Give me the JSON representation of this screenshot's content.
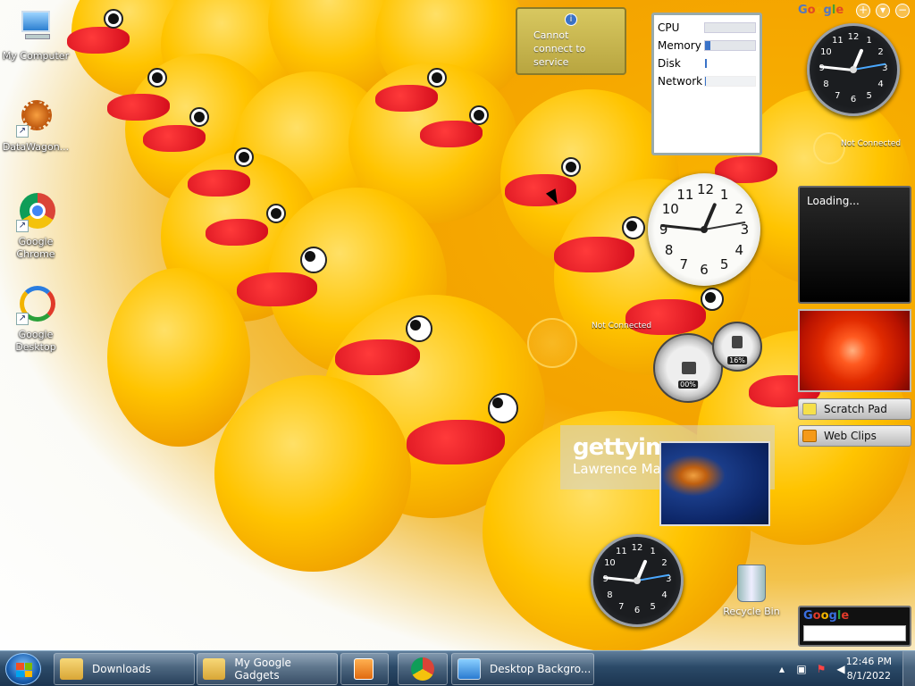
{
  "desktop_icons": [
    {
      "label": "My Computer",
      "icon": "computer-icon"
    },
    {
      "label": "DataWagon...",
      "icon": "datawagon-icon"
    },
    {
      "label": "Google Chrome",
      "icon": "chrome-icon"
    },
    {
      "label": "Google Desktop",
      "icon": "google-desktop-icon"
    }
  ],
  "weather_gadget": {
    "message": "Cannot connect to service",
    "info_icon": "i"
  },
  "system_monitor": {
    "rows": [
      {
        "label": "CPU",
        "level": 0.0
      },
      {
        "label": "Memory",
        "level": 0.1
      },
      {
        "label": "Disk",
        "level": 0.03
      },
      {
        "label": "Network",
        "level": 0.02
      }
    ]
  },
  "clock_top_right": {
    "not_connected": "Not Connected",
    "numerals": [
      "12",
      "1",
      "2",
      "3",
      "4",
      "5",
      "6",
      "7",
      "8",
      "9",
      "10",
      "11"
    ]
  },
  "clock_middle": {
    "not_connected": "Not Connected"
  },
  "gauges": {
    "cpu_percent": "00%",
    "memory_percent": "16%"
  },
  "slideshow": {
    "status": "Loading..."
  },
  "sidebar_buttons": {
    "scratch_pad": "Scratch Pad",
    "web_clips": "Web Clips"
  },
  "google_logo": [
    "G",
    "o",
    "o",
    "g",
    "l",
    "e"
  ],
  "getty_watermark": {
    "brand": "gettyimages",
    "credit": "Lawrence Ma"
  },
  "recycle_bin": {
    "label": "Recycle Bin"
  },
  "taskbar": {
    "buttons": [
      {
        "label": "Downloads",
        "icon": "folder-icon"
      },
      {
        "label": "My Google Gadgets",
        "icon": "folder-icon"
      },
      {
        "label": "",
        "icon": "media-player-icon"
      },
      {
        "label": "",
        "icon": "chrome-icon"
      },
      {
        "label": "Desktop Backgro...",
        "icon": "desktop-background-icon"
      }
    ],
    "time": "12:46 PM",
    "date": "8/1/2022"
  },
  "colors": {
    "taskbar": "#2b4a68",
    "accent_blue": "#3a73c8",
    "duck_yellow": "#ffc400",
    "beak_red": "#d10a1a"
  }
}
